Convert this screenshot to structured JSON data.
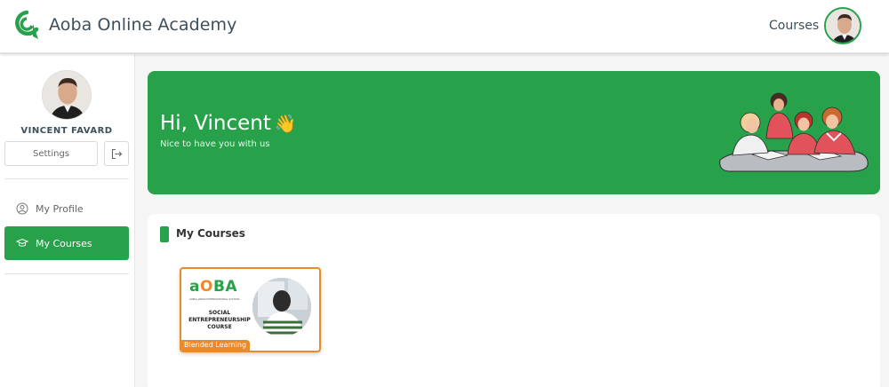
{
  "header": {
    "app_title": "Aoba Online Academy",
    "nav_courses": "Courses",
    "accent_color": "#27a24b"
  },
  "sidebar": {
    "user_name": "VINCENT FAVARD",
    "settings_label": "Settings",
    "items": [
      {
        "label": "My Profile",
        "icon": "user-circle-icon",
        "active": false
      },
      {
        "label": "My Courses",
        "icon": "graduation-cap-icon",
        "active": true
      }
    ]
  },
  "banner": {
    "greeting": "Hi, Vincent",
    "wave": "👋",
    "subtitle": "Nice to have you with us",
    "background": "#27a24b"
  },
  "courses": {
    "section_title": "My Courses",
    "cards": [
      {
        "brand_a": "a",
        "brand_b": "O",
        "brand_c": "BA",
        "school": "AOBA-JAPAN INTERNATIONAL SCHOOL",
        "title": "SOCIAL ENTREPRENEURSHIP COURSE",
        "tag": "Blended Learning",
        "accent": "#ec8a2a"
      }
    ]
  }
}
